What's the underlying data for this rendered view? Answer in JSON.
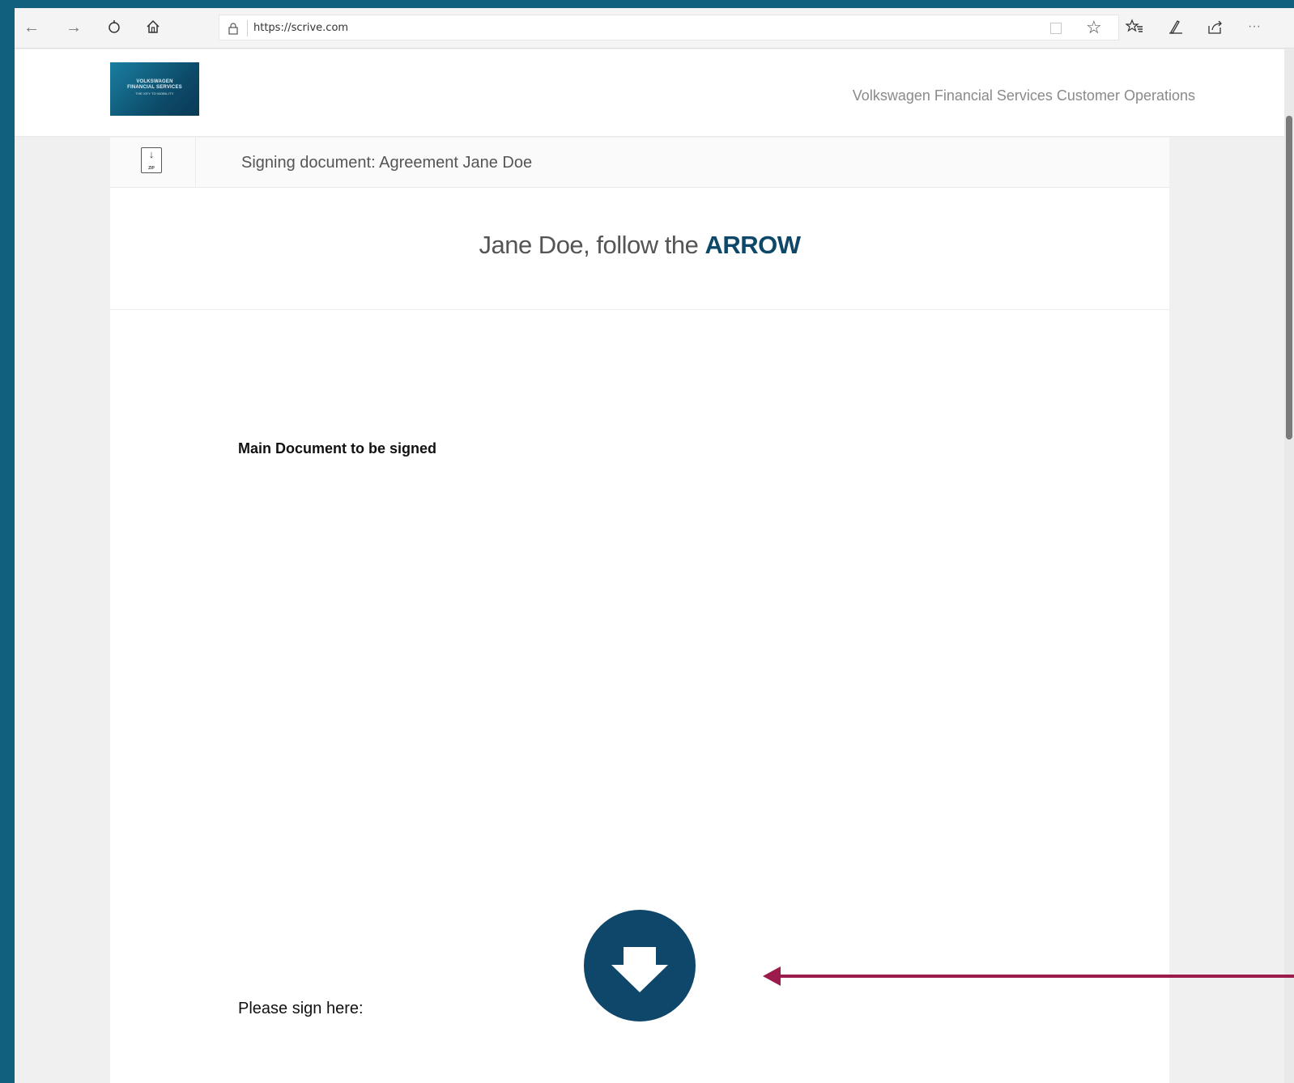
{
  "browser": {
    "url": "https://scrive.com"
  },
  "header": {
    "logo_lines": [
      "VOLKSWAGEN",
      "FINANCIAL SERVICES",
      "THE KEY TO MOBILITY"
    ],
    "org_name": "Volkswagen Financial Services Customer Operations"
  },
  "document": {
    "title": "Signing document: Agreement Jane Doe",
    "instruction_prefix": "Jane Doe, follow the ",
    "instruction_emphasis": "ARROW",
    "body_heading": "Main Document to be signed",
    "sign_label": "Please sign here:"
  },
  "colors": {
    "frame": "#11607e",
    "brand_dark": "#0e4769",
    "annotation_arrow": "#9b1b4c"
  },
  "icons": {
    "back": "arrow-left-icon",
    "forward": "arrow-right-icon",
    "refresh": "refresh-icon",
    "home": "home-icon",
    "lock": "lock-icon",
    "reading": "reading-view-icon",
    "favorite": "star-icon",
    "favorites_list": "favorites-icon",
    "notes": "pen-icon",
    "share": "share-icon",
    "more": "more-icon",
    "download_zip": "download-zip-icon",
    "next_step": "arrow-down-icon"
  }
}
